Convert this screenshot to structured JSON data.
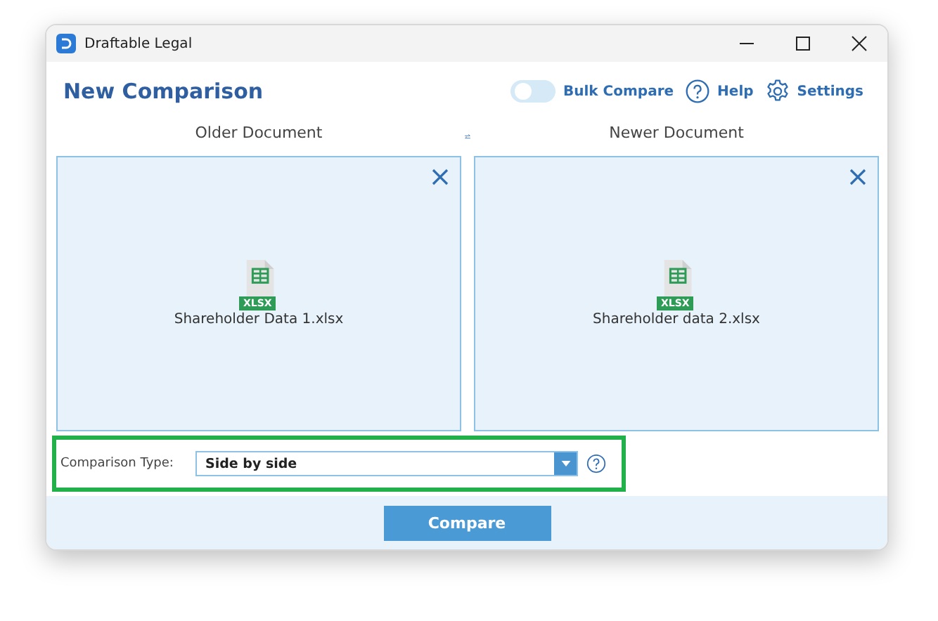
{
  "window": {
    "title": "Draftable Legal"
  },
  "header": {
    "title": "New Comparison",
    "bulk_compare": {
      "label": "Bulk Compare",
      "on": false
    },
    "help": "Help",
    "settings": "Settings"
  },
  "documents": [
    {
      "heading": "Older Document",
      "file_name": "Shareholder Data 1.xlsx",
      "file_type": "XLSX"
    },
    {
      "heading": "Newer Document",
      "file_name": "Shareholder data 2.xlsx",
      "file_type": "XLSX"
    }
  ],
  "comparison_type": {
    "label": "Comparison Type:",
    "value": "Side by side",
    "highlighted": true
  },
  "buttons": [
    "Compare"
  ]
}
